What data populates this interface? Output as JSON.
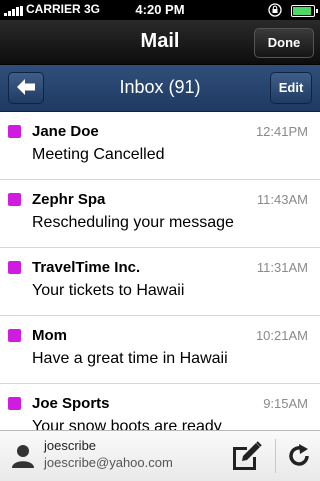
{
  "status_bar": {
    "carrier": "CARRIER 3G",
    "time": "4:20 PM",
    "icons": [
      "signal-icon",
      "rotation-lock-icon",
      "battery-icon"
    ],
    "battery_level": 0.9,
    "battery_color": "#4cd964"
  },
  "title_bar": {
    "title": "Mail",
    "done_label": "Done"
  },
  "inbox_bar": {
    "heading": "Inbox (91)",
    "back_icon": "back-arrow-icon",
    "edit_label": "Edit"
  },
  "messages": [
    {
      "sender": "Jane Doe",
      "time": "12:41PM",
      "subject": "Meeting Cancelled"
    },
    {
      "sender": "Zephr Spa",
      "time": "11:43AM",
      "subject": "Rescheduling your message"
    },
    {
      "sender": "TravelTime Inc.",
      "time": "11:31AM",
      "subject": "Your tickets to Hawaii"
    },
    {
      "sender": "Mom",
      "time": "10:21AM",
      "subject": "Have a great time in Hawaii"
    },
    {
      "sender": "Joe Sports",
      "time": "9:15AM",
      "subject": "Your snow boots are ready"
    }
  ],
  "unread_color": "#d01ce0",
  "bottom_bar": {
    "username": "joescribe",
    "email": "joescribe@yahoo.com",
    "icons": [
      "user-icon",
      "compose-icon",
      "refresh-icon"
    ]
  }
}
